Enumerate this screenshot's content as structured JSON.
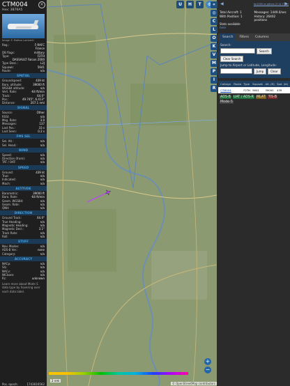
{
  "aircraft": {
    "callsign": "CTM004",
    "hex_label": "Hex: 3B76A5",
    "photo_credit": "Image © Matteo Lamberti",
    "basic": [
      {
        "k": "Reg.:",
        "v": "F-RAFC"
      },
      {
        "k": "",
        "v": "France"
      },
      {
        "k": "DB flags:",
        "v": "military"
      },
      {
        "k": "Type:",
        "v": "F2TH"
      },
      {
        "k": "",
        "v": "DASSAULT Falcon 2000"
      },
      {
        "k": "Type Desc.:",
        "v": "L2J"
      },
      {
        "k": "Squawk:",
        "v": "5641"
      },
      {
        "k": "Route:",
        "v": "n/a"
      }
    ],
    "sections": [
      {
        "title": "SPATIAL",
        "rows": [
          {
            "k": "Groundspeed:",
            "v": "439 kt"
          },
          {
            "k": "Baro. altitude:",
            "v": "39000 ft"
          },
          {
            "k": "WGS84 altitude:",
            "v": "n/a"
          },
          {
            "k": "Vert. Rate:",
            "v": "-64 ft/min"
          },
          {
            "k": "Track:",
            "v": "64.0°"
          },
          {
            "k": "Pos.:",
            "v": "49.745°, 6.413°"
          },
          {
            "k": "Distance:",
            "v": "207.1 nmi"
          }
        ]
      },
      {
        "title": "SIGNAL",
        "rows": [
          {
            "k": "Source:",
            "v": "Other"
          },
          {
            "k": "RSSI:",
            "v": "n/a"
          },
          {
            "k": "Msg. Rate:",
            "v": "3.0"
          },
          {
            "k": "Messages:",
            "v": "137"
          },
          {
            "k": "Last Pos.:",
            "v": "33 s"
          },
          {
            "k": "Last Seen:",
            "v": "0.2 s"
          }
        ]
      },
      {
        "title": "FMS SEL",
        "rows": [
          {
            "k": "Sel. Alt.:",
            "v": "n/a"
          },
          {
            "k": "Sel. Head.:",
            "v": "n/a"
          }
        ]
      },
      {
        "title": "WIND",
        "rows": [
          {
            "k": "Speed:",
            "v": "n/a"
          },
          {
            "k": "Direction (from):",
            "v": "n/a"
          },
          {
            "k": "TAT / OAT:",
            "v": "n/a"
          }
        ]
      },
      {
        "title": "SPEED",
        "rows": [
          {
            "k": "Ground:",
            "v": "439 kt"
          },
          {
            "k": "True:",
            "v": "n/a"
          },
          {
            "k": "Indicated:",
            "v": "n/a"
          },
          {
            "k": "Mach:",
            "v": "n/a"
          }
        ]
      },
      {
        "title": "ALTITUDE",
        "rows": [
          {
            "k": "Barometric:",
            "v": "39000 ft"
          },
          {
            "k": "Baro. Rate:",
            "v": "-64 ft/min"
          },
          {
            "k": "Geom. WGS84:",
            "v": "n/a"
          },
          {
            "k": "Geom. Rate:",
            "v": "n/a"
          },
          {
            "k": "QNH:",
            "v": "n/a"
          }
        ]
      },
      {
        "title": "DIRECTION",
        "rows": [
          {
            "k": "Ground Track:",
            "v": "64.0°"
          },
          {
            "k": "True Heading:",
            "v": "n/a"
          },
          {
            "k": "Magnetic Heading:",
            "v": "n/a"
          },
          {
            "k": "Magnetic Decl.:",
            "v": "3.1°"
          },
          {
            "k": "Track Rate:",
            "v": "n/a"
          },
          {
            "k": "Roll:",
            "v": "n/a"
          }
        ]
      },
      {
        "title": "STUFF",
        "rows": [
          {
            "k": "Nav. Modes:",
            "v": "n/a"
          },
          {
            "k": "ADS-B Ver.:",
            "v": "none"
          },
          {
            "k": "Category:",
            "v": "n/a"
          }
        ]
      },
      {
        "title": "ACCURACY",
        "rows": [
          {
            "k": "NACp:",
            "v": "n/a"
          },
          {
            "k": "SIL:",
            "v": "n/a"
          },
          {
            "k": "NACv:",
            "v": "n/a"
          },
          {
            "k": "NICbaro:",
            "v": "n/a"
          },
          {
            "k": "Rc:",
            "v": "unknown"
          }
        ]
      }
    ],
    "note": "Learn more about Mode S data type by hovering over each data label.",
    "epoch_label": "Pos. epoch:",
    "epoch_value": "1743616562"
  },
  "map": {
    "buttons": [
      "U",
      "H",
      "T"
    ],
    "scale": "2 nmi",
    "attribution": "© OpenStreetMap contributors",
    "zoom_in": "+",
    "zoom_out": "−"
  },
  "strip": [
    "C",
    "L",
    "O",
    "K",
    "V",
    "M",
    "P",
    "I",
    "R"
  ],
  "right": {
    "nav_left": "◀",
    "nav_right": "▶",
    "top_link": "tar1090 on github (3.14.1701)",
    "stats": {
      "total": "Total Aircraft: 1",
      "messages": "Messages: 1449.0/sec",
      "with_position": "With Position: 1",
      "history": "History: 26402 positions",
      "available": "Stats available",
      "link": "here"
    },
    "tabs": [
      "Search",
      "Filters",
      "Columns"
    ],
    "search_label": "Search:",
    "search_btn": "Search",
    "clear_btn": "Clear Search",
    "jump_label": "Jump to Airport or Latitude, Longitude:",
    "jump_btn": "Jump",
    "jump_clear": "Clear",
    "table_headers": [
      "",
      "Callsign",
      "Route",
      "Type",
      "Squawk",
      "Alt. (ft)",
      "Spd. (kt)"
    ],
    "table_rows": [
      [
        "",
        "CTM004",
        "",
        "F2TH",
        "5641",
        "39000",
        "439"
      ]
    ],
    "legend": [
      {
        "label": "ADS-B",
        "color": "#1f6f3a"
      },
      {
        "label": "UAT / ADS-R",
        "color": "#1f6f3a"
      },
      {
        "label": "MLAT",
        "color": "#7a5b1a"
      },
      {
        "label": "TIS-B",
        "color": "#7a2a2a"
      },
      {
        "label": "Mode-S",
        "color": "#444"
      }
    ]
  }
}
